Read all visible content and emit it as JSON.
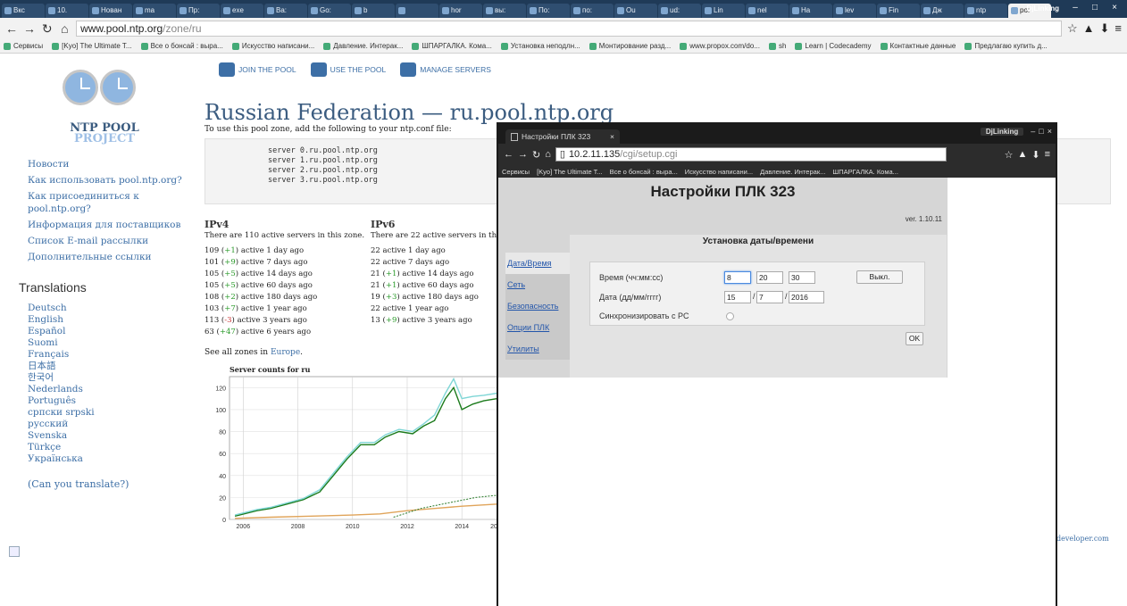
{
  "browser": {
    "tabs": [
      "Вкс",
      "10.",
      "Нован",
      "ma",
      "Пр:",
      "exe",
      "Ва:",
      "Go:",
      "b",
      "",
      "hor",
      "вы:",
      "По:",
      "по:",
      "Ou",
      "ud:",
      "Lin",
      "nel",
      "На",
      "lev",
      "Fin",
      "Дж",
      "ntp",
      "po:"
    ],
    "user": "DjLinking",
    "url_host": "www.pool.ntp.org",
    "url_path": "/zone/ru",
    "bookmarks": [
      "Сервисы",
      "[Kyo] The Ultimate T...",
      "Все о бонсай : выра...",
      "Искусство написани...",
      "Давление. Интерак...",
      "ШПАРГАЛКА. Кома...",
      "Установка неподлн...",
      "Монтирование разд...",
      "www.propox.com/do...",
      "sh",
      "Learn | Codecademy",
      "Контактные данные",
      "Предлагаю купить д..."
    ]
  },
  "ntp": {
    "logo_line1": "NTP POOL",
    "logo_line2": "PROJECT",
    "nav": [
      "JOIN THE POOL",
      "USE THE POOL",
      "MANAGE SERVERS"
    ],
    "side_links": [
      "Новости",
      "Как использовать pool.ntp.org?",
      "Как присоединиться к pool.ntp.org?",
      "Информация для поставщиков",
      "Список E-mail рассылки",
      "Дополнительные ссылки"
    ],
    "translations_heading": "Translations",
    "languages": [
      "Deutsch",
      "English",
      "Español",
      "Suomi",
      "Français",
      "日本語",
      "한국어",
      "Nederlands",
      "Português",
      "српски srpski",
      "русский",
      "Svenska",
      "Türkçe",
      "Українська"
    ],
    "can_translate": "(Can you translate?)",
    "title": "Russian Federation — ru.pool.ntp.org",
    "subtitle": "To use this pool zone, add the following to your ntp.conf file:",
    "servers": [
      "server 0.ru.pool.ntp.org",
      "server 1.ru.pool.ntp.org",
      "server 2.ru.pool.ntp.org",
      "server 3.ru.pool.ntp.org"
    ],
    "ipv4": {
      "heading": "IPv4",
      "summary": "There are 110 active servers in this zone.",
      "rows": [
        {
          "n": "109",
          "d": "+1",
          "s": "g",
          "t": "active 1 day ago"
        },
        {
          "n": "101",
          "d": "+9",
          "s": "g",
          "t": "active 7 days ago"
        },
        {
          "n": "105",
          "d": "+5",
          "s": "g",
          "t": "active 14 days ago"
        },
        {
          "n": "105",
          "d": "+5",
          "s": "g",
          "t": "active 60 days ago"
        },
        {
          "n": "108",
          "d": "+2",
          "s": "g",
          "t": "active 180 days ago"
        },
        {
          "n": "103",
          "d": "+7",
          "s": "g",
          "t": "active 1 year ago"
        },
        {
          "n": "113",
          "d": "-3",
          "s": "r",
          "t": "active 3 years ago"
        },
        {
          "n": "63",
          "d": "+47",
          "s": "g",
          "t": "active 6 years ago"
        }
      ]
    },
    "ipv6": {
      "heading": "IPv6",
      "summary": "There are 22 active servers in th",
      "rows": [
        {
          "n": "22",
          "d": "",
          "s": "",
          "t": "active 1 day ago"
        },
        {
          "n": "22",
          "d": "",
          "s": "",
          "t": "active 7 days ago"
        },
        {
          "n": "21",
          "d": "+1",
          "s": "g",
          "t": "active 14 days ago"
        },
        {
          "n": "21",
          "d": "+1",
          "s": "g",
          "t": "active 60 days ago"
        },
        {
          "n": "19",
          "d": "+3",
          "s": "g",
          "t": "active 180 days ago"
        },
        {
          "n": "22",
          "d": "",
          "s": "",
          "t": "active 1 year ago"
        },
        {
          "n": "13",
          "d": "+9",
          "s": "g",
          "t": "active 3 years ago"
        }
      ]
    },
    "see_all_prefix": "See all zones in ",
    "see_all_link": "Europe",
    "see_all_suffix": ".",
    "chart_title": "Server counts for ru",
    "footer": "developer.com"
  },
  "chart_data": {
    "type": "line",
    "title": "Server counts for ru",
    "x_ticks": [
      "2006",
      "2008",
      "2010",
      "2012",
      "2014",
      "20"
    ],
    "y_ticks": [
      "0",
      "20",
      "40",
      "60",
      "80",
      "100",
      "120"
    ],
    "ylim": [
      0,
      130
    ],
    "xlim": [
      2005.5,
      2015.3
    ],
    "grid": true,
    "series": [
      {
        "color": "#1b7a1b",
        "x": [
          2005.7,
          2006.5,
          2007.0,
          2007.6,
          2008.2,
          2008.8,
          2009.3,
          2009.8,
          2010.3,
          2010.8,
          2011.2,
          2011.7,
          2012.2,
          2012.6,
          2013.0,
          2013.4,
          2013.7,
          2014.0,
          2014.4,
          2014.8,
          2015.3
        ],
        "y": [
          3,
          8,
          10,
          14,
          18,
          25,
          40,
          55,
          68,
          68,
          75,
          80,
          78,
          85,
          90,
          110,
          120,
          100,
          105,
          108,
          110
        ]
      },
      {
        "color": "#7fd6d6",
        "x": [
          2005.7,
          2006.5,
          2007.0,
          2007.6,
          2008.2,
          2008.8,
          2009.3,
          2009.8,
          2010.3,
          2010.8,
          2011.2,
          2011.7,
          2012.2,
          2012.6,
          2013.0,
          2013.4,
          2013.7,
          2014.0,
          2014.4,
          2014.8,
          2015.3
        ],
        "y": [
          4,
          9,
          11,
          15,
          19,
          27,
          42,
          57,
          70,
          70,
          77,
          82,
          80,
          87,
          95,
          115,
          128,
          110,
          112,
          113,
          115
        ]
      },
      {
        "color": "#e0a45a",
        "x": [
          2005.7,
          2007.0,
          2008.5,
          2010.0,
          2011.0,
          2012.0,
          2013.0,
          2014.0,
          2015.3
        ],
        "y": [
          1,
          2,
          3,
          4,
          5,
          8,
          10,
          12,
          14
        ]
      },
      {
        "color": "#2a7a2a",
        "x": [
          2011.5,
          2012.5,
          2013.5,
          2014.5,
          2015.3
        ],
        "y": [
          2,
          10,
          15,
          20,
          22
        ]
      }
    ]
  },
  "plc": {
    "tab_title": "Настройки ПЛК 323",
    "tab_close": "×",
    "user": "DjLinking",
    "url_host": "10.2.11.135",
    "url_path": "/cgi/setup.cgi",
    "bookmarks": [
      "Сервисы",
      "[Kyo] The Ultimate T...",
      "Все о бонсай : выра...",
      "Искусство написани...",
      "Давление. Интерак...",
      "ШПАРГАЛКА. Кома..."
    ],
    "title": "Настройки ПЛК 323",
    "version": "ver. 1.10.11",
    "menu": [
      "Дата/Время",
      "Сеть",
      "Безопасность",
      "Опции ПЛК",
      "Утилиты"
    ],
    "panel_title": "Установка даты/времени",
    "time_label": "Время (чч:мм:сс)",
    "time": [
      "8",
      "20",
      "30"
    ],
    "off_button": "Выкл.",
    "date_label": "Дата (дд/мм/гггг)",
    "date": [
      "15",
      "7",
      "2016"
    ],
    "sync_label": "Синхронизировать с PC",
    "ok_button": "OK"
  }
}
